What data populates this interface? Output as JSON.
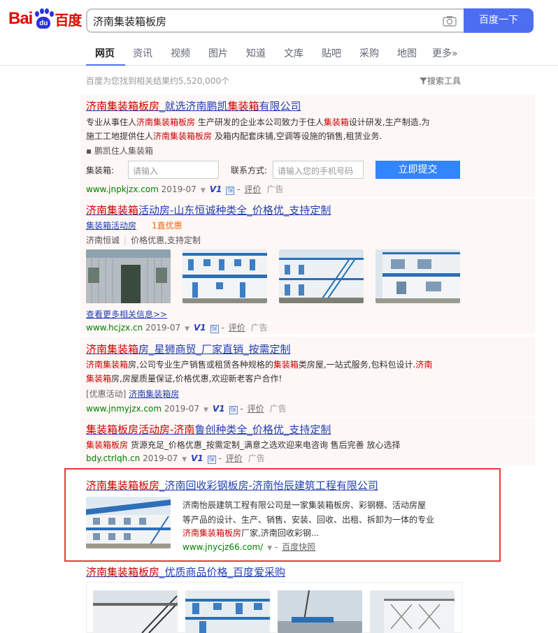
{
  "header": {
    "logo_bai": "Bai",
    "logo_du": "du",
    "logo_cn": "百度",
    "query": "济南集装箱板房",
    "search_button": "百度一下"
  },
  "tabs": [
    "网页",
    "资讯",
    "视频",
    "图片",
    "知道",
    "文库",
    "贴吧",
    "采购",
    "地图",
    "更多»"
  ],
  "result_count": "百度为您找到相关结果约5,520,000个",
  "search_tools": "搜索工具",
  "r1": {
    "title_a": "济南集装箱板房",
    "title_b": "_就选济南鹏凯",
    "title_c": "集装箱",
    "title_d": "有限公司",
    "desc1_a": "专业从事住人",
    "desc1_b": "济南集装箱板房",
    "desc1_c": " 生产研发的企业本公司致力于住人",
    "desc1_d": "集装箱",
    "desc1_e": "设计研发,生产制造.为",
    "desc2_a": "施工工地提供住人",
    "desc2_b": "济南集装箱板房",
    "desc2_c": " 及箱内配套床铺,空调等设施的销售,租赁业务.",
    "sub": "▪ 鹏凯住人集装箱",
    "form_label1": "集装箱:",
    "form_ph1": "请输入",
    "form_label2": "联系方式:",
    "form_ph2": "请输入您的手机号码",
    "submit": "立即提交",
    "url": "www.jnpkjzx.com",
    "date": "2019-07",
    "v": "V1",
    "bz": "保",
    "review": "评价",
    "ad": "广告"
  },
  "r2": {
    "title_a": "济南集装箱",
    "title_b": "活动房-山东恒诚种类全_价格优_支持定制",
    "link1": "集装箱活动房",
    "promo": "1直优惠",
    "tags_a": "济南恒诚",
    "tags_b": "价格优惠,支持定制",
    "more": "查看更多相关信息>>",
    "url": "www.hcjzx.cn",
    "date": "2019-07",
    "v": "V1",
    "bz": "保",
    "review": "评价",
    "ad": "广告"
  },
  "r3": {
    "title_a": "济南集装箱",
    "title_b": "房_星狮商贸_厂家直销_按需定制",
    "desc1_a": "济南集装箱",
    "desc1_b": "房,公司专业生产销售或租赁各种规格的",
    "desc1_c": "集装箱",
    "desc1_d": "类房屋,一站式服务,包料包设计.",
    "desc1_e": "济南",
    "desc2_a": "集装箱",
    "desc2_b": "房,房屋质量保证,价格优惠,欢迎新老客户合作!",
    "promo_label": "[优惠活动]",
    "promo_link": "济南集装箱房",
    "url": "www.jnmyjzx.com",
    "date": "2019-07",
    "v": "V1",
    "bz": "保",
    "review": "评价",
    "ad": "广告"
  },
  "r4": {
    "title_a": "集装箱板房活动房-济南",
    "title_b": "鲁创种类全_价格优_支持定制",
    "desc_a": "集装箱板房",
    "desc_b": " 货源充足_价格优惠_按需定制_满意之选欢迎来电咨询 售后完善 放心选择",
    "url": "bdy.ctrlqh.cn",
    "date": "2019-07",
    "v": "V1",
    "bz": "保",
    "review": "评价",
    "ad": "广告"
  },
  "r5": {
    "title_a": "济南集装箱板房",
    "title_b": "_济南回收彩钢板房-济南怡辰建筑工程有限公司",
    "desc1": "济南怡辰建筑工程有限公司是一家集装箱板房、彩钢棚、活动房屋",
    "desc2": "等产品的设计、生产、销售、安装、回收、出租、拆卸为一体的专业",
    "desc3_a": "济南集装箱板房",
    "desc3_b": "厂家,济南回收彩钢...",
    "url": "www.jnycjz66.com/",
    "snapshot": "百度快照"
  },
  "r6": {
    "title_a": "济南集装箱板房",
    "title_b": "_优质商品价格_百度爱采购"
  },
  "colors": {
    "accent": "#4e6ef2",
    "title_link": "#2440b3",
    "highlight": "#cc0000",
    "url_green": "#008000",
    "highlight_box": "#e83a3a"
  }
}
